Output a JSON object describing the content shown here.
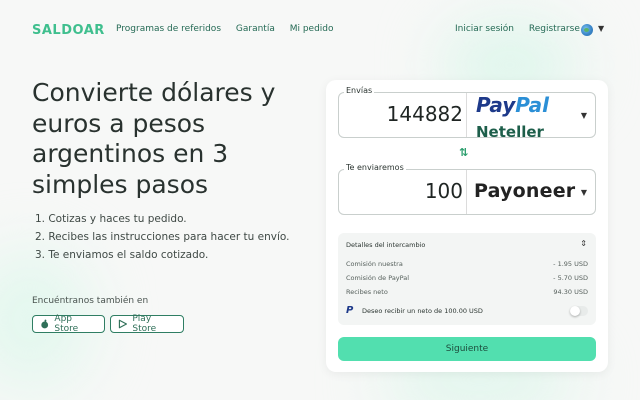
{
  "brand": "SALDOAR",
  "nav": {
    "left": [
      "Programas de referidos",
      "Garantía",
      "Mi pedido"
    ],
    "login": "Iniciar sesión",
    "register": "Registrarse"
  },
  "hero": {
    "title": "Convierte dólares y euros a pesos argentinos en 3 simples pasos",
    "steps": [
      "1.  Cotizas y haces tu pedido.",
      "2.  Recibes las instrucciones para hacer tu envío.",
      "3.  Te enviamos el saldo cotizado."
    ],
    "find_us": "Encuéntranos también en",
    "app_store": "App Store",
    "play_store": "Play Store"
  },
  "converter": {
    "send_label": "Envías",
    "send_amount": "144882",
    "send_provider_top": "PayPal",
    "send_provider_top_a": "Pay",
    "send_provider_top_b": "Pal",
    "send_provider_next": "Neteller",
    "receive_label": "Te enviaremos",
    "receive_amount": "100",
    "receive_provider": "Payoneer",
    "details_title": "Detalles del intercambio",
    "rows": [
      {
        "label": "Comisión nuestra",
        "value": "- 1.95 USD"
      },
      {
        "label": "Comisión de PayPal",
        "value": "- 5.70 USD"
      },
      {
        "label": "Recibes neto",
        "value": "94.30 USD"
      }
    ],
    "wish_text": "Deseo recibir un neto de 100.00 USD",
    "submit": "Siguiente"
  },
  "colors": {
    "accent": "#52dfaf",
    "brand": "#3fbf8e",
    "paypal_dark": "#1e3a8a",
    "paypal_light": "#2b8fd6"
  },
  "icons": {
    "globe": "globe-icon",
    "apple": "apple-icon",
    "play": "play-store-icon",
    "swap": "swap-arrows-icon"
  }
}
